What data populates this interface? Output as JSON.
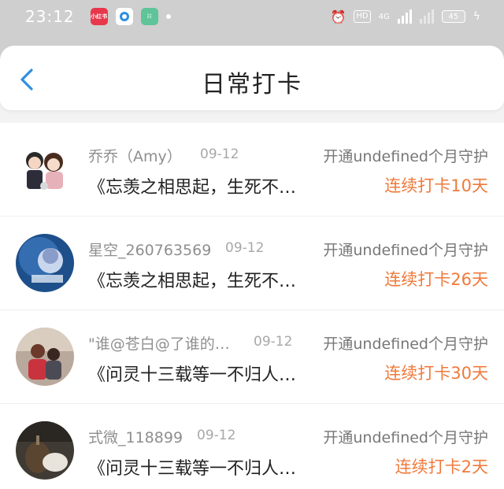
{
  "status_bar": {
    "time": "23:12",
    "app_icons": [
      "xiaohongshu-icon",
      "app-blue-icon",
      "app-green-icon"
    ],
    "network": "4G",
    "battery": "45"
  },
  "header": {
    "title": "日常打卡",
    "back_icon": "chevron-left-icon"
  },
  "colors": {
    "accent_blue": "#2f8fe0",
    "streak_orange": "#ef7a3c"
  },
  "entries": [
    {
      "name": "乔乔（Amy）",
      "date": "09-12",
      "guard_text": "开通undefined个月守护",
      "content": "《忘羡之相思起，生死不…",
      "streak": "连续打卡10天"
    },
    {
      "name": "星空_260763569",
      "date": "09-12",
      "guard_text": "开通undefined个月守护",
      "content": "《忘羡之相思起，生死不…",
      "streak": "连续打卡26天"
    },
    {
      "name": "\"谁@苍白@了谁的…",
      "date": "09-12",
      "guard_text": "开通undefined个月守护",
      "content": "《问灵十三载等一不归人…",
      "streak": "连续打卡30天"
    },
    {
      "name": "式微_118899",
      "date": "09-12",
      "guard_text": "开通undefined个月守护",
      "content": "《问灵十三载等一不归人…",
      "streak": "连续打卡2天"
    }
  ]
}
